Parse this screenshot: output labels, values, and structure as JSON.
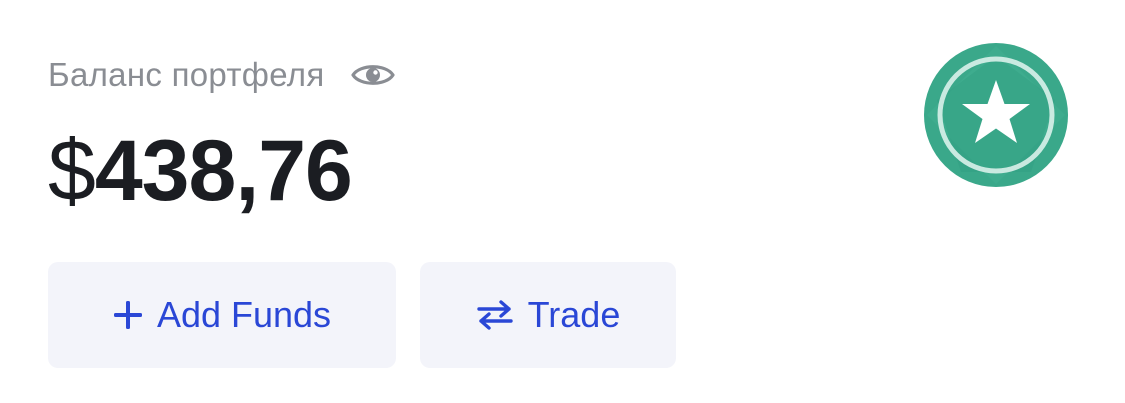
{
  "portfolio": {
    "label": "Баланс портфеля",
    "currency_symbol": "$",
    "amount": "438,76",
    "visibility_icon": "eye-icon"
  },
  "badge": {
    "icon": "star-badge-icon",
    "color": "#3aa88a"
  },
  "actions": {
    "add_funds": {
      "label": "Add Funds",
      "icon": "plus-icon"
    },
    "trade": {
      "label": "Trade",
      "icon": "swap-arrows-icon"
    }
  },
  "colors": {
    "accent": "#2a47d6",
    "button_bg": "#f3f4fa",
    "label_gray": "#8a8d93",
    "text_dark": "#1b1d22"
  }
}
